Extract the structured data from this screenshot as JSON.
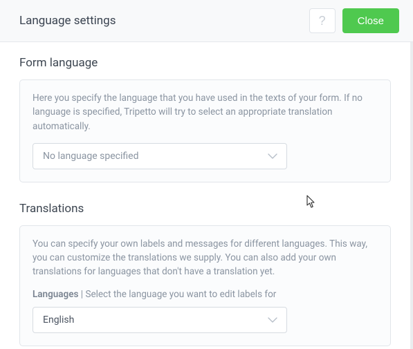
{
  "header": {
    "title": "Language settings",
    "help_label": "?",
    "close_label": "Close"
  },
  "form_language": {
    "title": "Form language",
    "description": "Here you specify the language that you have used in the texts of your form. If no language is specified, Tripetto will try to select an appropriate translation automatically.",
    "select_value": "No language specified"
  },
  "translations": {
    "title": "Translations",
    "description": "You can specify your own labels and messages for different languages. This way, you can customize the translations we supply. You can also add your own translations for languages that don't have a translation yet.",
    "sublabel_strong": "Languages",
    "sublabel_rest": " | Select the language you want to edit labels for",
    "select_value": "English"
  }
}
